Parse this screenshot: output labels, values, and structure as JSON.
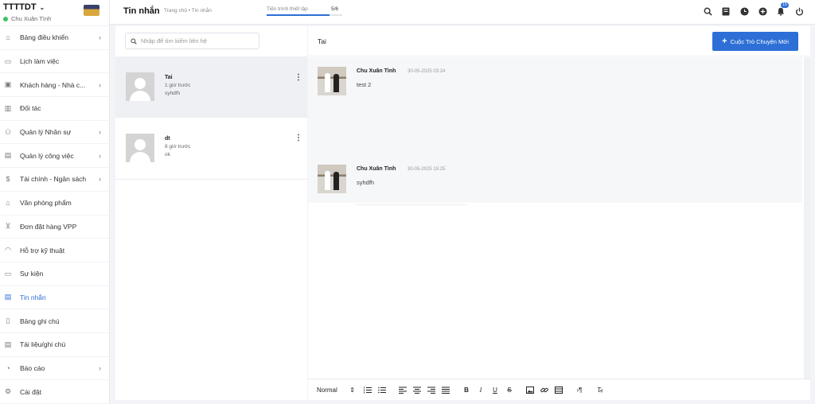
{
  "brand": {
    "name": "TTTTDT",
    "user": "Chu Xuân Tình"
  },
  "sidebar": {
    "items": [
      {
        "label": "Bảng điều khiển",
        "icon": "home-icon",
        "glyph": "⌂",
        "has_submenu": true
      },
      {
        "label": "Lịch làm việc",
        "icon": "calendar-icon",
        "glyph": "▭",
        "has_submenu": false
      },
      {
        "label": "Khách hàng - Nhà c...",
        "icon": "customer-card-icon",
        "glyph": "▣",
        "has_submenu": true
      },
      {
        "label": "Đối tác",
        "icon": "bar-chart-icon",
        "glyph": "▥",
        "has_submenu": false
      },
      {
        "label": "Quản lý Nhân sự",
        "icon": "people-icon",
        "glyph": "⚇",
        "has_submenu": true
      },
      {
        "label": "Quản lý công việc",
        "icon": "briefcase-icon",
        "glyph": "▤",
        "has_submenu": true
      },
      {
        "label": "Tài chính - Ngân sách",
        "icon": "dollar-icon",
        "glyph": "$",
        "has_submenu": true
      },
      {
        "label": "Văn phòng phẩm",
        "icon": "bank-icon",
        "glyph": "⌂",
        "has_submenu": false
      },
      {
        "label": "Đơn đặt hàng VPP",
        "icon": "cart-icon",
        "glyph": "⊻",
        "has_submenu": false
      },
      {
        "label": "Hỗ trợ kỹ thuật",
        "icon": "headset-icon",
        "glyph": "◠",
        "has_submenu": false
      },
      {
        "label": "Sự kiện",
        "icon": "event-calendar-icon",
        "glyph": "▭",
        "has_submenu": false
      },
      {
        "label": "Tin nhắn",
        "icon": "message-icon",
        "glyph": "▤",
        "has_submenu": false,
        "active": true
      },
      {
        "label": "Bảng ghi chú",
        "icon": "clipboard-icon",
        "glyph": "▯",
        "has_submenu": false
      },
      {
        "label": "Tài liệu/ghi chú",
        "icon": "document-icon",
        "glyph": "▤",
        "has_submenu": false
      },
      {
        "label": "Báo cáo",
        "icon": "pie-chart-icon",
        "glyph": "◔",
        "has_submenu": true
      },
      {
        "label": "Cài đặt",
        "icon": "gear-icon",
        "glyph": "⚙",
        "has_submenu": false
      }
    ]
  },
  "header": {
    "title": "Tin nhắn",
    "breadcrumb": "Trang chủ • Tin nhắn",
    "progress_label": "Tiến trình thiết lập",
    "progress_count": "5/6",
    "progress_fraction": 0.8333,
    "notification_count": "15"
  },
  "contacts": {
    "search_placeholder": "Nhập để tìm kiếm liên hệ",
    "items": [
      {
        "name": "Tai",
        "time": "1 giờ trước",
        "last_message": "syhdfh",
        "selected": true
      },
      {
        "name": "dt",
        "time": "8 giờ trước",
        "last_message": "ok",
        "selected": false
      }
    ]
  },
  "chat": {
    "title": "Tai",
    "new_button_label": "Cuộc Trò Chuyện Mới",
    "messages": [
      {
        "author": "Chu Xuân Tình",
        "time": "30-05-2025 03:24",
        "text": "test 2"
      },
      {
        "author": "Chu Xuân Tình",
        "time": "30-05-2025 15:25",
        "text": "syhdfh"
      }
    ]
  },
  "editor": {
    "format_label": "Normal"
  },
  "colors": {
    "accent": "#2d6fd6",
    "online": "#3cc160"
  }
}
